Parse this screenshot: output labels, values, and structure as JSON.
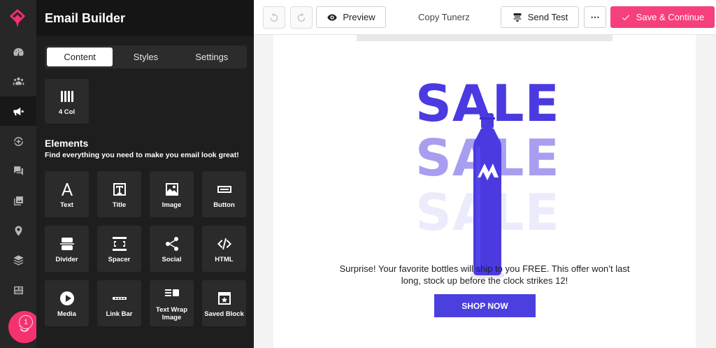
{
  "app": {
    "panel_title": "Email Builder"
  },
  "rail": {
    "items": [
      "dashboard-icon",
      "people-icon",
      "megaphone-icon",
      "automation-icon",
      "chat-icon",
      "gallery-icon",
      "location-icon",
      "layers-icon",
      "newspaper-icon"
    ],
    "active": "megaphone-icon",
    "fab_badge": "1"
  },
  "tabs": {
    "content": "Content",
    "styles": "Styles",
    "settings": "Settings",
    "active": "content"
  },
  "layout_blocks": {
    "four_col": "4 Col"
  },
  "elements": {
    "title": "Elements",
    "subtitle": "Find everything you need to make you email look great!",
    "items": {
      "text": "Text",
      "title": "Title",
      "image": "Image",
      "button": "Button",
      "divider": "Divider",
      "spacer": "Spacer",
      "social": "Social",
      "html": "HTML",
      "media": "Media",
      "link_bar": "Link Bar",
      "text_wrap": "Text Wrap Image",
      "saved": "Saved Block"
    }
  },
  "toolbar": {
    "preview": "Preview",
    "doc_name": "Copy Tunerz",
    "send_test": "Send Test",
    "more": "⋯",
    "save": "Save & Continue"
  },
  "email": {
    "hero_word": "SALE",
    "promo": "Surprise! Your favorite bottles will ship to you FREE. This offer won’t last long, stock up before the clock strikes 12!",
    "cta": "SHOP NOW"
  },
  "colors": {
    "accent": "#f6407b",
    "brand_purple": "#4b3fe0"
  }
}
